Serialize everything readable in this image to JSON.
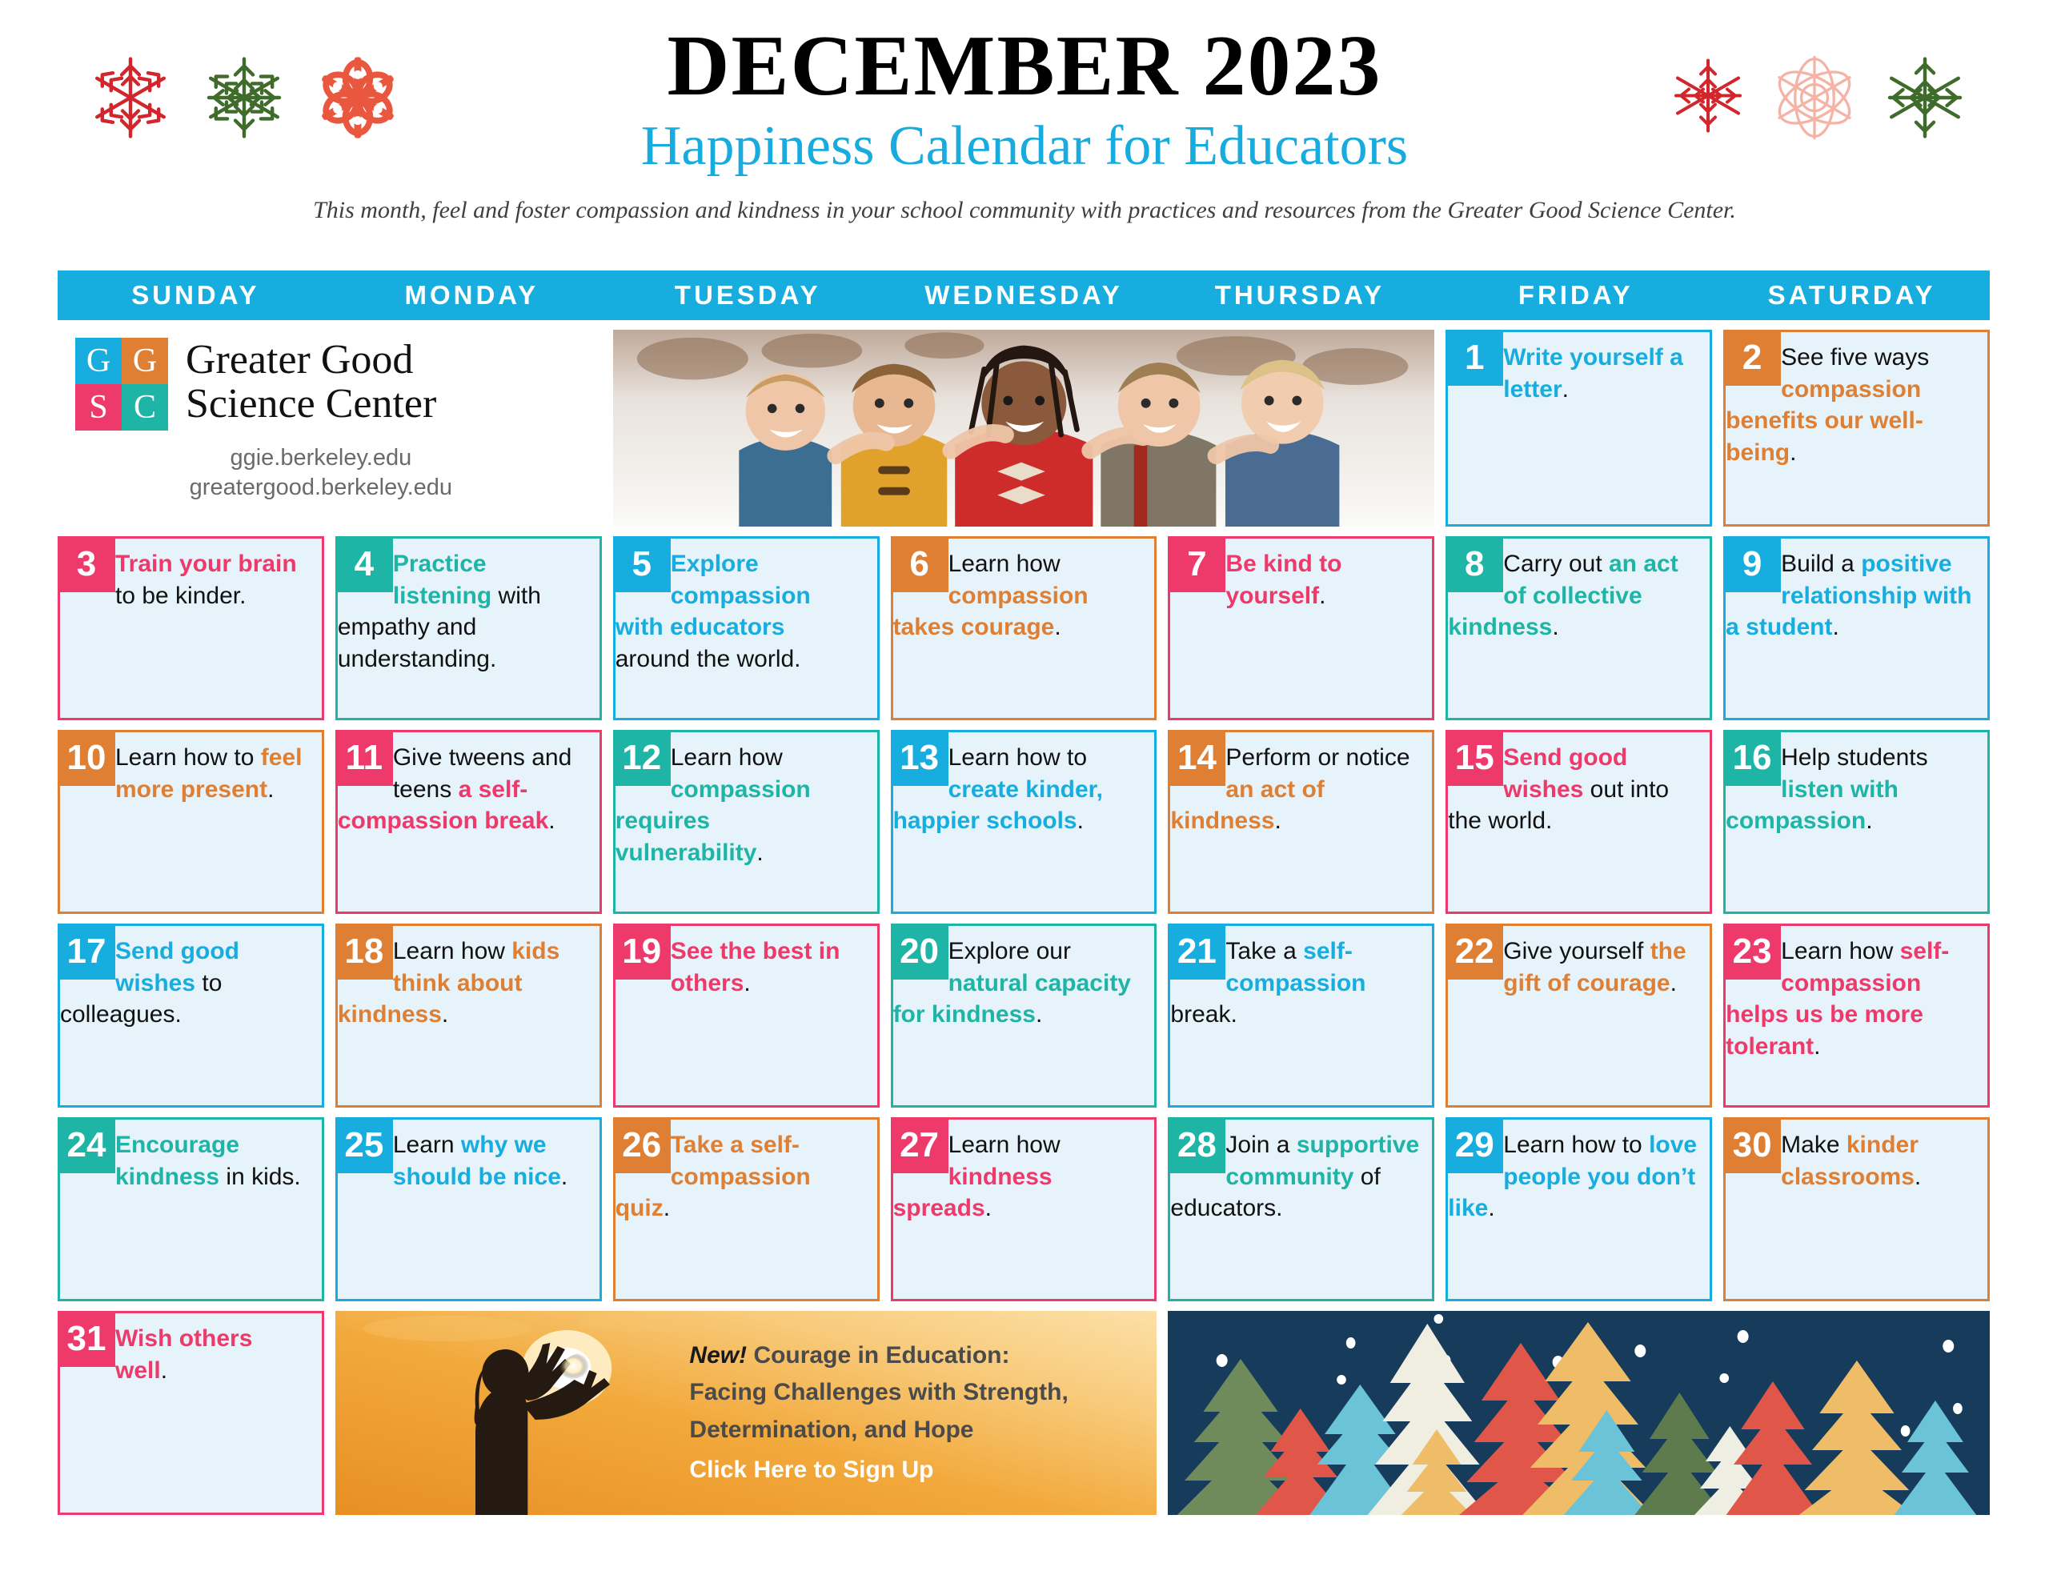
{
  "header": {
    "month_title": "DECEMBER 2023",
    "subtitle": "Happiness Calendar for Educators",
    "tagline": "This month, feel and foster compassion and kindness in your school community with practices and resources from the Greater Good Science Center.",
    "snowflakes_left": [
      "snowflake-red",
      "snowflake-green",
      "snowflake-coral"
    ],
    "snowflakes_right": [
      "snowflake-red",
      "snowflake-pink",
      "snowflake-green"
    ],
    "colors": {
      "blue": "#17ADDE",
      "orange": "#DF7F33",
      "pink": "#EE3A6B",
      "teal": "#1FB5A6",
      "cell_bg": "#E7F3FA",
      "title_black": "#000000",
      "tree_night": "#173B5A"
    }
  },
  "weekdays": [
    "SUNDAY",
    "MONDAY",
    "TUESDAY",
    "WEDNESDAY",
    "THURSDAY",
    "FRIDAY",
    "SATURDAY"
  ],
  "logo": {
    "squares": [
      "G",
      "G",
      "S",
      "C"
    ],
    "name_line1": "Greater Good",
    "name_line2": "Science Center",
    "url1": "ggie.berkeley.edu",
    "url2": "greatergood.berkeley.edu"
  },
  "photo": {
    "alt": "five smiling children hugging outdoors in winter"
  },
  "promo": {
    "new_label": "New!",
    "line1": " Courage in Education:",
    "line2": "Facing Challenges with Strength,",
    "line3": "Determination, and Hope",
    "cta": "Click Here to Sign Up",
    "image_alt": "silhouette of a person reaching toward the sunset"
  },
  "trees": {
    "alt": "illustrated winter forest of colorful pine trees at night with snow"
  },
  "days": [
    {
      "n": "1",
      "color": "blue",
      "parts": [
        {
          "t": "Write yourself a letter",
          "b": true
        },
        {
          "t": ".",
          "b": false
        }
      ]
    },
    {
      "n": "2",
      "color": "orange",
      "parts": [
        {
          "t": "See five ways ",
          "b": false
        },
        {
          "t": "compassion benefits our well-being",
          "b": true
        },
        {
          "t": ".",
          "b": false
        }
      ]
    },
    {
      "n": "3",
      "color": "pink",
      "parts": [
        {
          "t": "Train your brain",
          "b": true
        },
        {
          "t": " to be kinder.",
          "b": false
        }
      ]
    },
    {
      "n": "4",
      "color": "teal",
      "parts": [
        {
          "t": "Practice listening",
          "b": true
        },
        {
          "t": " with empathy and understanding.",
          "b": false
        }
      ]
    },
    {
      "n": "5",
      "color": "blue",
      "parts": [
        {
          "t": "Explore compassion with educators",
          "b": true
        },
        {
          "t": " around the world.",
          "b": false
        }
      ]
    },
    {
      "n": "6",
      "color": "orange",
      "parts": [
        {
          "t": "Learn how ",
          "b": false
        },
        {
          "t": "compassion takes courage",
          "b": true
        },
        {
          "t": ".",
          "b": false
        }
      ]
    },
    {
      "n": "7",
      "color": "pink",
      "parts": [
        {
          "t": "Be kind to yourself",
          "b": true
        },
        {
          "t": ".",
          "b": false
        }
      ]
    },
    {
      "n": "8",
      "color": "teal",
      "parts": [
        {
          "t": "Carry out ",
          "b": false
        },
        {
          "t": "an act of collective kindness",
          "b": true
        },
        {
          "t": ".",
          "b": false
        }
      ]
    },
    {
      "n": "9",
      "color": "blue",
      "parts": [
        {
          "t": "Build a ",
          "b": false
        },
        {
          "t": "positive relationship with a student",
          "b": true
        },
        {
          "t": ".",
          "b": false
        }
      ]
    },
    {
      "n": "10",
      "color": "orange",
      "parts": [
        {
          "t": "Learn how to ",
          "b": false
        },
        {
          "t": "feel more present",
          "b": true
        },
        {
          "t": ".",
          "b": false
        }
      ]
    },
    {
      "n": "11",
      "color": "pink",
      "parts": [
        {
          "t": "Give tweens and teens ",
          "b": false
        },
        {
          "t": "a self-compassion break",
          "b": true
        },
        {
          "t": ".",
          "b": false
        }
      ]
    },
    {
      "n": "12",
      "color": "teal",
      "parts": [
        {
          "t": "Learn how ",
          "b": false
        },
        {
          "t": "compassion requires vulnerability",
          "b": true
        },
        {
          "t": ".",
          "b": false
        }
      ]
    },
    {
      "n": "13",
      "color": "blue",
      "parts": [
        {
          "t": "Learn how to ",
          "b": false
        },
        {
          "t": "create kinder, happier schools",
          "b": true
        },
        {
          "t": ".",
          "b": false
        }
      ]
    },
    {
      "n": "14",
      "color": "orange",
      "parts": [
        {
          "t": "Perform or notice ",
          "b": false
        },
        {
          "t": "an act of kindness",
          "b": true
        },
        {
          "t": ".",
          "b": false
        }
      ]
    },
    {
      "n": "15",
      "color": "pink",
      "parts": [
        {
          "t": "Send good wishes",
          "b": true
        },
        {
          "t": " out into the world.",
          "b": false
        }
      ]
    },
    {
      "n": "16",
      "color": "teal",
      "parts": [
        {
          "t": "Help students ",
          "b": false
        },
        {
          "t": "listen with compassion",
          "b": true
        },
        {
          "t": ".",
          "b": false
        }
      ]
    },
    {
      "n": "17",
      "color": "blue",
      "parts": [
        {
          "t": "Send good wishes",
          "b": true
        },
        {
          "t": " to colleagues.",
          "b": false
        }
      ]
    },
    {
      "n": "18",
      "color": "orange",
      "parts": [
        {
          "t": "Learn how ",
          "b": false
        },
        {
          "t": "kids think about kindness",
          "b": true
        },
        {
          "t": ".",
          "b": false
        }
      ]
    },
    {
      "n": "19",
      "color": "pink",
      "parts": [
        {
          "t": "See the best in others",
          "b": true
        },
        {
          "t": ".",
          "b": false
        }
      ]
    },
    {
      "n": "20",
      "color": "teal",
      "parts": [
        {
          "t": "Explore our ",
          "b": false
        },
        {
          "t": "natural capacity for kindness",
          "b": true
        },
        {
          "t": ".",
          "b": false
        }
      ]
    },
    {
      "n": "21",
      "color": "blue",
      "parts": [
        {
          "t": "Take a ",
          "b": false
        },
        {
          "t": "self-compassion",
          "b": true
        },
        {
          "t": " break.",
          "b": false
        }
      ]
    },
    {
      "n": "22",
      "color": "orange",
      "parts": [
        {
          "t": "Give yourself ",
          "b": false
        },
        {
          "t": "the gift of courage",
          "b": true
        },
        {
          "t": ".",
          "b": false
        }
      ]
    },
    {
      "n": "23",
      "color": "pink",
      "parts": [
        {
          "t": "Learn how ",
          "b": false
        },
        {
          "t": "self-compassion helps us be more tolerant",
          "b": true
        },
        {
          "t": ".",
          "b": false
        }
      ]
    },
    {
      "n": "24",
      "color": "teal",
      "parts": [
        {
          "t": "Encourage kindness",
          "b": true
        },
        {
          "t": " in kids.",
          "b": false
        }
      ]
    },
    {
      "n": "25",
      "color": "blue",
      "parts": [
        {
          "t": "Learn ",
          "b": false
        },
        {
          "t": "why we should be nice",
          "b": true
        },
        {
          "t": ".",
          "b": false
        }
      ]
    },
    {
      "n": "26",
      "color": "orange",
      "parts": [
        {
          "t": "Take a self-compassion quiz",
          "b": true
        },
        {
          "t": ".",
          "b": false
        }
      ]
    },
    {
      "n": "27",
      "color": "pink",
      "parts": [
        {
          "t": "Learn how ",
          "b": false
        },
        {
          "t": "kindness spreads",
          "b": true
        },
        {
          "t": ".",
          "b": false
        }
      ]
    },
    {
      "n": "28",
      "color": "teal",
      "parts": [
        {
          "t": "Join a ",
          "b": false
        },
        {
          "t": "supportive community",
          "b": true
        },
        {
          "t": " of educators.",
          "b": false
        }
      ]
    },
    {
      "n": "29",
      "color": "blue",
      "parts": [
        {
          "t": "Learn how to ",
          "b": false
        },
        {
          "t": "love people you don’t like",
          "b": true
        },
        {
          "t": ".",
          "b": false
        }
      ]
    },
    {
      "n": "30",
      "color": "orange",
      "parts": [
        {
          "t": "Make ",
          "b": false
        },
        {
          "t": "kinder classrooms",
          "b": true
        },
        {
          "t": ".",
          "b": false
        }
      ]
    },
    {
      "n": "31",
      "color": "pink",
      "parts": [
        {
          "t": "Wish others well",
          "b": true
        },
        {
          "t": ".",
          "b": false
        }
      ]
    }
  ]
}
